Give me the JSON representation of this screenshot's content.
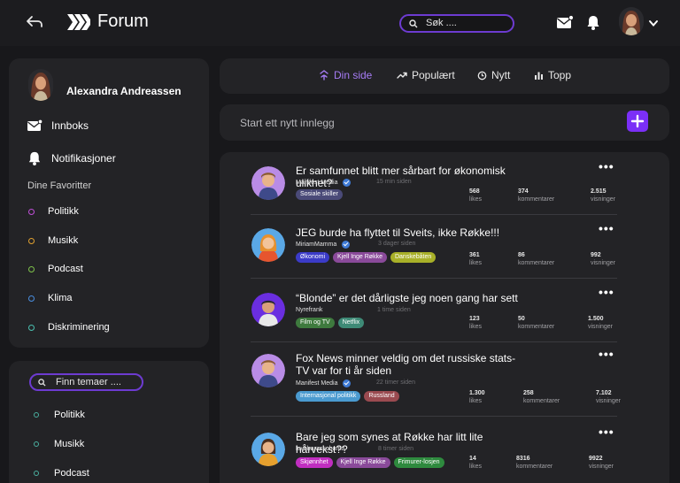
{
  "header": {
    "title": "Forum",
    "search_placeholder": "Søk ...."
  },
  "profile": {
    "name": "Alexandra Andreassen",
    "inbox_label": "Innboks",
    "notifications_label": "Notifikasjoner",
    "favorites_heading": "Dine Favoritter",
    "favorites": [
      {
        "label": "Politikk",
        "color": "#c04fd8"
      },
      {
        "label": "Musikk",
        "color": "#e0a030"
      },
      {
        "label": "Podcast",
        "color": "#7ec24a"
      },
      {
        "label": "Klima",
        "color": "#4a8ee0"
      },
      {
        "label": "Diskriminering",
        "color": "#4ac0b0"
      }
    ]
  },
  "topics": {
    "search_placeholder": "Finn temaer ....",
    "items": [
      "Politikk",
      "Musikk",
      "Podcast"
    ]
  },
  "tabs": [
    {
      "label": "Din side",
      "icon": "home-icon",
      "active": true
    },
    {
      "label": "Populært",
      "icon": "trend-icon",
      "active": false
    },
    {
      "label": "Nytt",
      "icon": "clock-icon",
      "active": false
    },
    {
      "label": "Topp",
      "icon": "bar-chart-icon",
      "active": false
    }
  ],
  "new_post": {
    "placeholder": "Start ett nytt innlegg",
    "button": "+"
  },
  "posts": [
    {
      "title": "Er samfunnet blitt mer sårbart for økonomisk ulikhet?",
      "author": "Manifest Media",
      "verified": true,
      "time": "15 min siden",
      "tags": [
        {
          "label": "Sosiale skiller",
          "color": "#4a4a78"
        }
      ],
      "likes": "568",
      "likes_label": "likes",
      "comments": "374",
      "comments_label": "kommentarer",
      "views": "2.515",
      "views_label": "visninger"
    },
    {
      "title": "JEG burde ha flyttet til Sveits, ikke Røkke!!!",
      "author": "MiriamMamma",
      "verified": true,
      "time": "3 dager siden",
      "tags": [
        {
          "label": "Økonomi",
          "color": "#3b3bc8"
        },
        {
          "label": "Kjell Inge Røkke",
          "color": "#8a4a9a"
        },
        {
          "label": "Danskebåten",
          "color": "#a8b028"
        }
      ],
      "likes": "361",
      "likes_label": "likes",
      "comments": "86",
      "comments_label": "kommentarer",
      "views": "992",
      "views_label": "visninger"
    },
    {
      "title": "“Blonde” er det dårligste jeg noen gang har sett",
      "author": "Nyrefrank",
      "verified": false,
      "time": "1 time siden",
      "tags": [
        {
          "label": "Film og TV",
          "color": "#3e7a3e"
        },
        {
          "label": "Netflix",
          "color": "#3e8a76"
        }
      ],
      "likes": "123",
      "likes_label": "likes",
      "comments": "50",
      "comments_label": "kommentarer",
      "views": "1.500",
      "views_label": "visninger"
    },
    {
      "title": "Fox News minner veldig om det russiske stats-TV var for ti år siden",
      "author": "Manifest Media",
      "verified": true,
      "time": "22 timer siden",
      "tags": [
        {
          "label": "Internasjonal politikk",
          "color": "#4a9ad0"
        },
        {
          "label": "Russland",
          "color": "#9a4a50"
        }
      ],
      "likes": "1.300",
      "likes_label": "likes",
      "comments": "258",
      "comments_label": "kommentarer",
      "views": "7.102",
      "views_label": "visninger"
    },
    {
      "title": "Bare jeg som synes at Røkke har litt lite hårvekst??",
      "author": "lovebarackobama",
      "verified": false,
      "time": "8 timer siden",
      "tags": [
        {
          "label": "Skjønnhet",
          "color": "#c02ec0"
        },
        {
          "label": "Kjell Inge Røkke",
          "color": "#8a4a9a"
        },
        {
          "label": "Frimurer-losjen",
          "color": "#2e8a3e"
        }
      ],
      "likes": "14",
      "likes_label": "likes",
      "comments": "8316",
      "comments_label": "kommentarer",
      "views": "9922",
      "views_label": "visninger"
    }
  ]
}
